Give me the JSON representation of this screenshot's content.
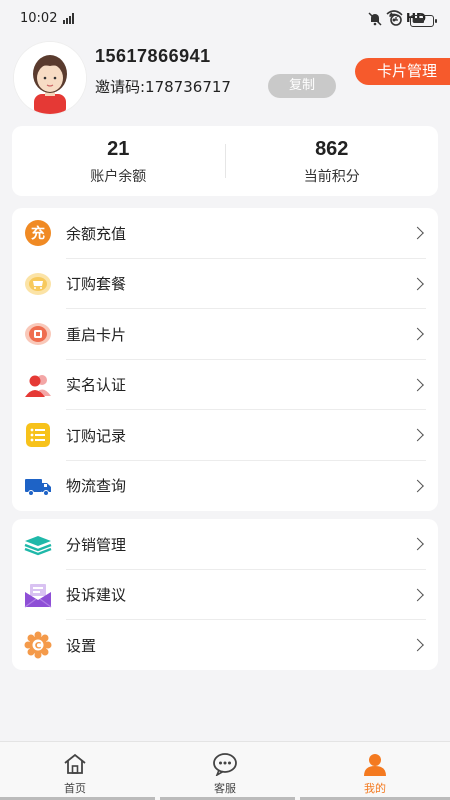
{
  "status_bar": {
    "time": "10:02",
    "network": "HD"
  },
  "profile": {
    "phone": "15617866941",
    "invite_code": "邀请码:178736717",
    "copy_label": "复制",
    "card_manage_label": "卡片管理"
  },
  "stats": [
    {
      "value": "21",
      "label": "账户余额"
    },
    {
      "value": "862",
      "label": "当前积分"
    }
  ],
  "menu_group_1": [
    {
      "label": "余额充值",
      "icon": "recharge-icon"
    },
    {
      "label": "订购套餐",
      "icon": "cart-icon"
    },
    {
      "label": "重启卡片",
      "icon": "restart-card-icon"
    },
    {
      "label": "实名认证",
      "icon": "users-icon"
    },
    {
      "label": "订购记录",
      "icon": "list-icon"
    },
    {
      "label": "物流查询",
      "icon": "truck-icon"
    }
  ],
  "menu_group_2": [
    {
      "label": "分销管理",
      "icon": "layers-icon"
    },
    {
      "label": "投诉建议",
      "icon": "mail-icon"
    },
    {
      "label": "设置",
      "icon": "settings-icon"
    }
  ],
  "tabs": [
    {
      "label": "首页",
      "icon": "home-icon"
    },
    {
      "label": "客服",
      "icon": "chat-icon"
    },
    {
      "label": "我的",
      "icon": "profile-icon"
    }
  ],
  "colors": {
    "accent": "#f65a2c",
    "active_tab": "#f47a20",
    "background": "#f4f4f6"
  }
}
